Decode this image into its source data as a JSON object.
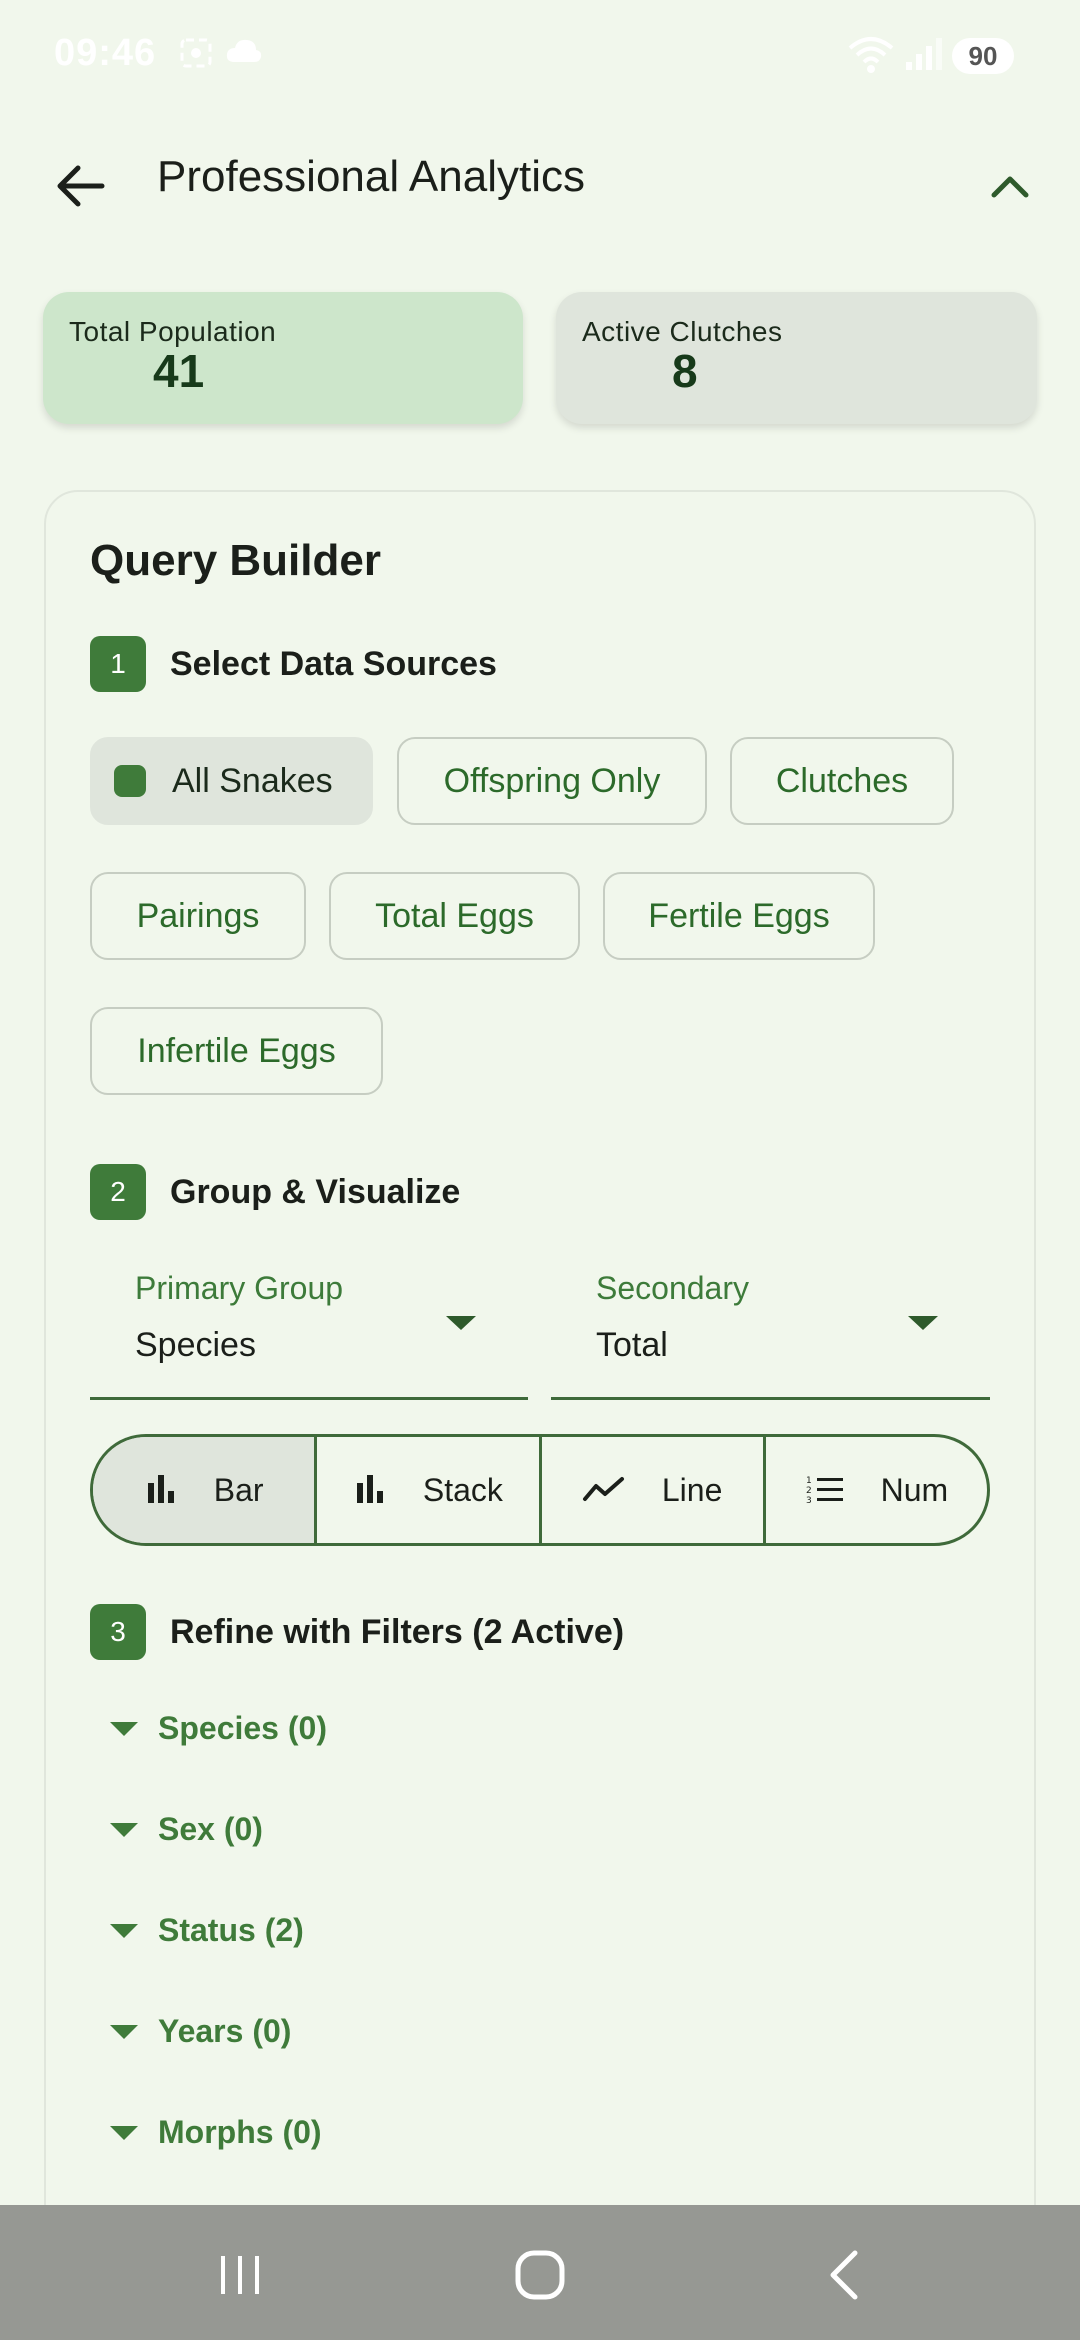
{
  "status_bar": {
    "time": "09:46",
    "battery": "90",
    "icons": [
      "screenshot-icon",
      "cloud-icon",
      "wifi-icon",
      "signal-icon"
    ]
  },
  "header": {
    "title": "Professional Analytics",
    "back_icon": "arrow-left-icon",
    "collapse_icon": "chevron-up-icon"
  },
  "summary": {
    "total_population": {
      "label": "Total Population",
      "value": "41"
    },
    "active_clutches": {
      "label": "Active Clutches",
      "value": "8"
    }
  },
  "query_builder": {
    "title": "Query Builder",
    "step1": {
      "number": "1",
      "label": "Select Data Sources",
      "chips": [
        {
          "label": "All Snakes",
          "selected": true
        },
        {
          "label": "Offspring Only",
          "selected": false
        },
        {
          "label": "Clutches",
          "selected": false
        },
        {
          "label": "Pairings",
          "selected": false
        },
        {
          "label": "Total Eggs",
          "selected": false
        },
        {
          "label": "Fertile Eggs",
          "selected": false
        },
        {
          "label": "Infertile Eggs",
          "selected": false
        }
      ]
    },
    "step2": {
      "number": "2",
      "label": "Group & Visualize",
      "primary_group": {
        "label": "Primary Group",
        "value": "Species"
      },
      "secondary": {
        "label": "Secondary",
        "value": "Total"
      },
      "chart_types": [
        {
          "label": "Bar",
          "icon": "bar-chart-icon",
          "active": true
        },
        {
          "label": "Stack",
          "icon": "stacked-bar-icon",
          "active": false
        },
        {
          "label": "Line",
          "icon": "line-chart-icon",
          "active": false
        },
        {
          "label": "Num",
          "icon": "numbered-list-icon",
          "active": false
        }
      ]
    },
    "step3": {
      "number": "3",
      "label": "Refine with Filters (2 Active)",
      "filters": [
        {
          "label": "Species (0)"
        },
        {
          "label": "Sex (0)"
        },
        {
          "label": "Status (2)"
        },
        {
          "label": "Years (0)"
        },
        {
          "label": "Morphs (0)"
        }
      ]
    }
  },
  "colors": {
    "background": "#f1f7ec",
    "accent": "#3f7b3a",
    "population_card": "#cde6cb",
    "clutches_card": "#dfe5dc",
    "nav_bar": "#969893"
  },
  "nav_bar": {
    "icons": [
      "recent-apps-icon",
      "home-icon",
      "back-icon"
    ]
  }
}
